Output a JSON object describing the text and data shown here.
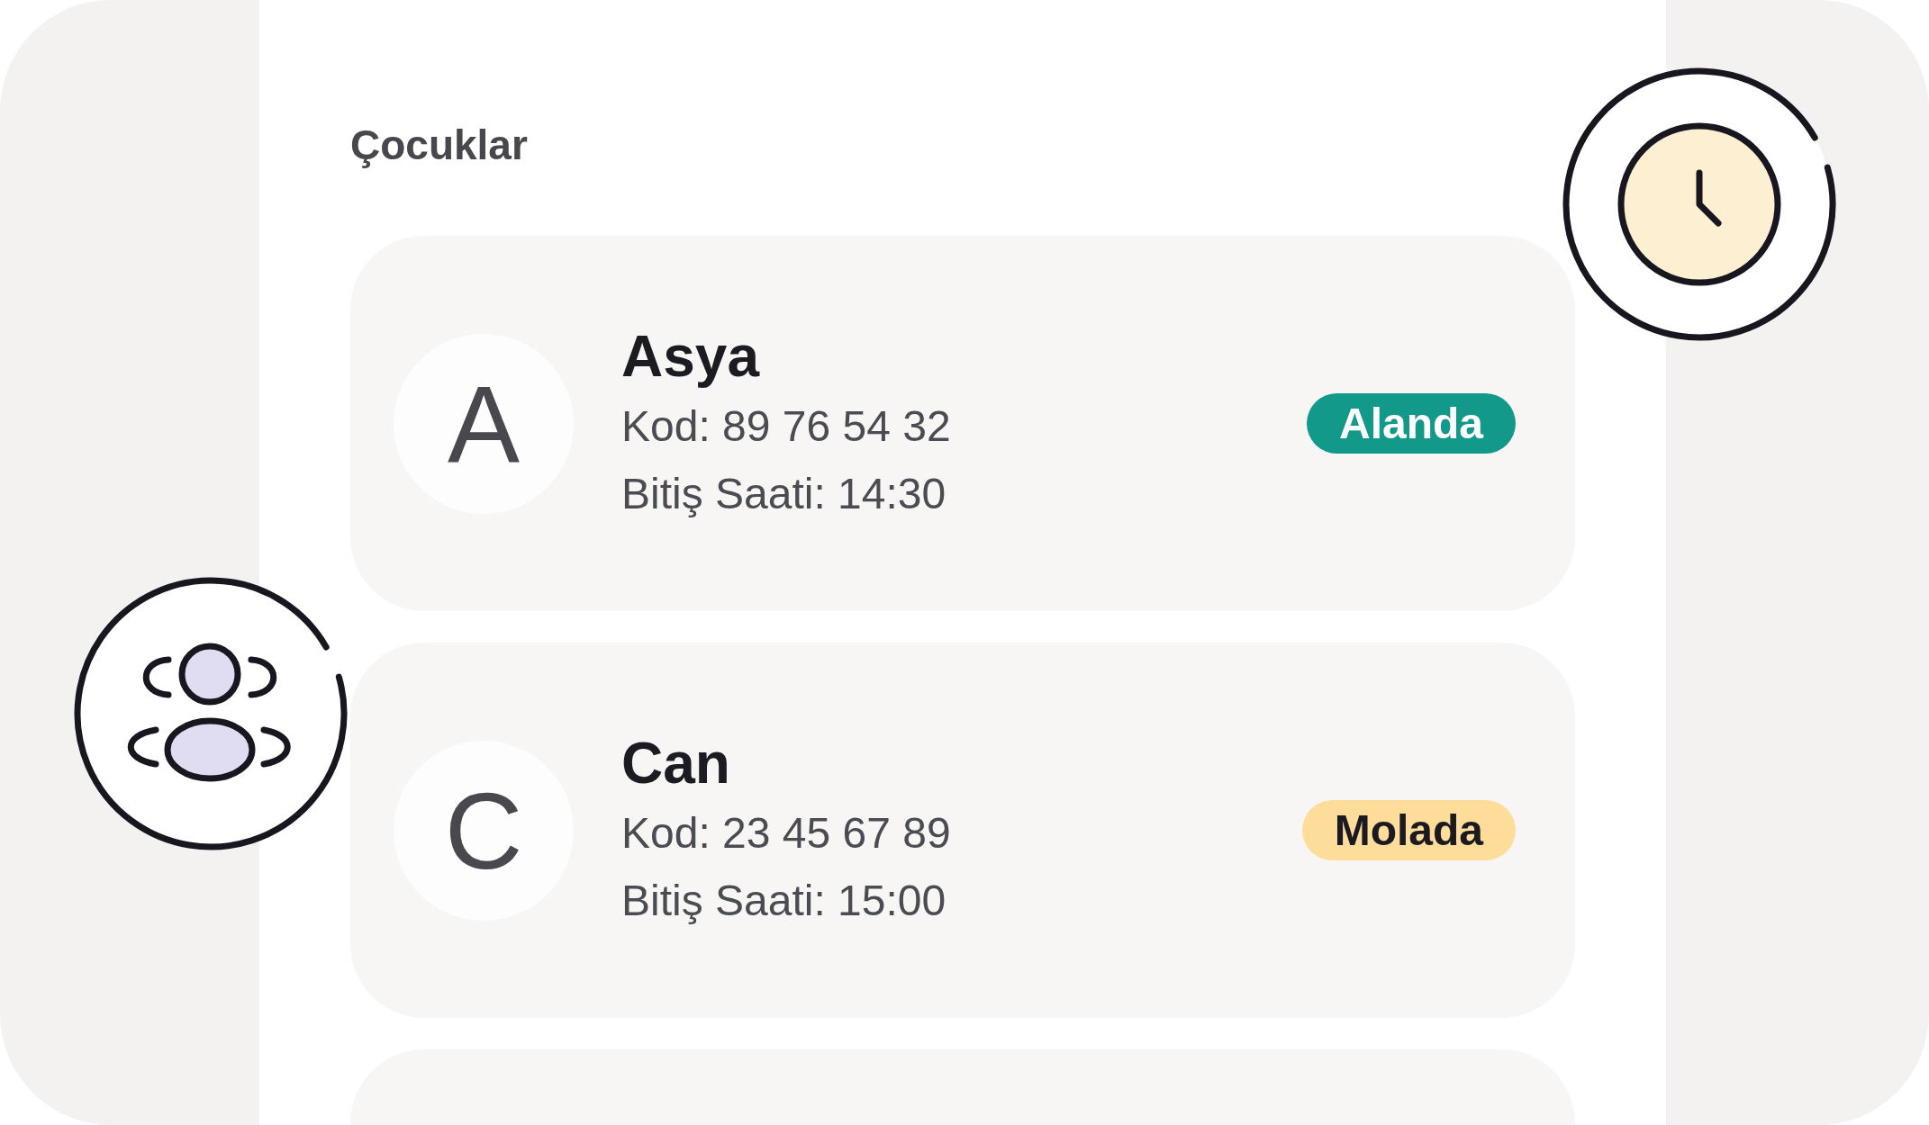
{
  "title": "Çocuklar",
  "children": [
    {
      "initial": "A",
      "name": "Asya",
      "code": "Kod: 89 76 54 32",
      "end_time": "Bitiş Saati: 14:30",
      "status": {
        "label": "Alanda",
        "kind": "present"
      }
    },
    {
      "initial": "C",
      "name": "Can",
      "code": "Kod: 23 45 67 89",
      "end_time": "Bitiş Saati: 15:00",
      "status": {
        "label": "Molada",
        "kind": "break"
      }
    }
  ]
}
